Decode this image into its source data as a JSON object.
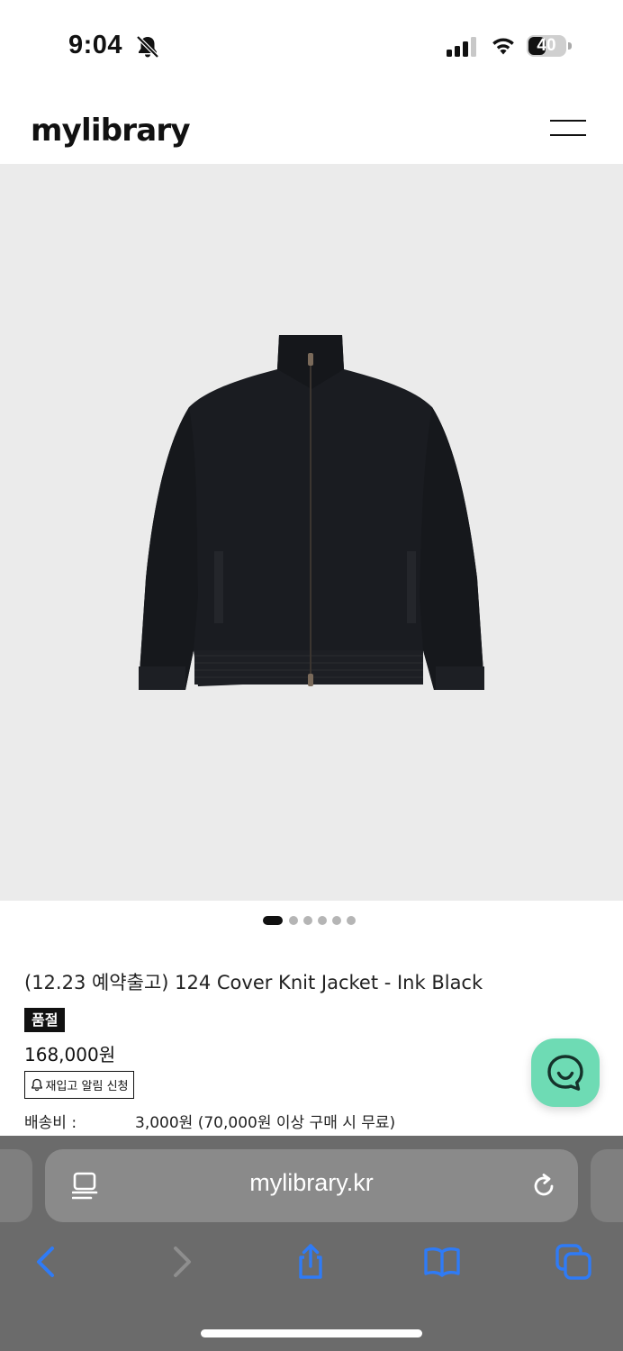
{
  "status_bar": {
    "time": "9:04",
    "battery_percent": "40",
    "icons": [
      "bell-slash-icon",
      "cellular-signal-icon",
      "wifi-icon",
      "battery-icon"
    ]
  },
  "header": {
    "logo": "mylibrary",
    "menu_icon": "hamburger-menu-icon"
  },
  "gallery": {
    "image": "jacket-product-photo",
    "background_color": "#ebebeb",
    "slide_count": 6,
    "active_slide": 1
  },
  "product": {
    "title": "(12.23 예약출고) 124 Cover Knit Jacket - Ink Black",
    "soldout_badge": "품절",
    "price": "168,000원",
    "restock_button": "재입고 알림 신청",
    "shipping_label": "배송비 :",
    "shipping_value": "3,000원 (70,000원 이상 구매 시 무료)"
  },
  "chat": {
    "icon": "chat-bubble-icon",
    "color": "#6edbb4"
  },
  "browser": {
    "url": "mylibrary.kr",
    "icons": [
      "reader-mode-icon",
      "reload-icon",
      "back-icon",
      "forward-icon",
      "share-icon",
      "bookmarks-icon",
      "tabs-icon"
    ],
    "accent_color": "#2f7bf6"
  }
}
